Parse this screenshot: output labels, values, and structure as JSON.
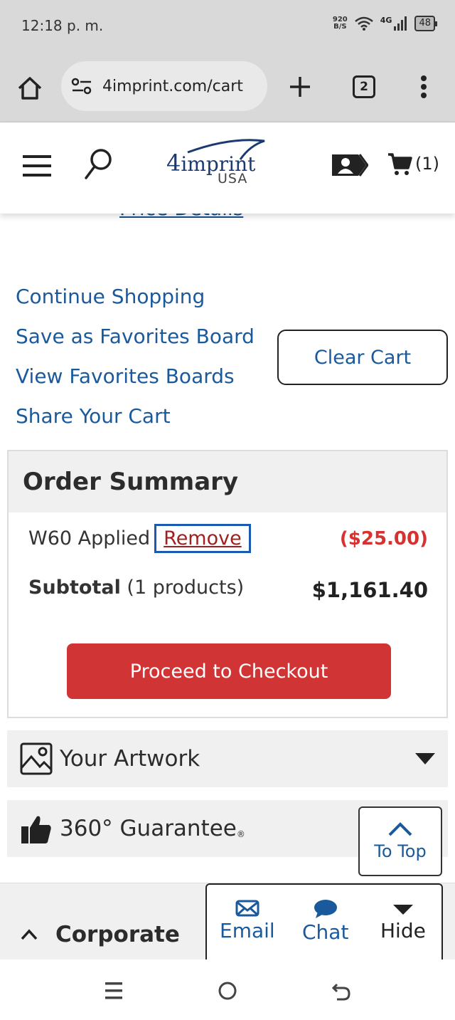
{
  "status_bar": {
    "time": "12:18 p. m.",
    "net_speed_value": "920",
    "net_speed_unit": "B/S",
    "network_type": "4G",
    "battery": "48"
  },
  "browser": {
    "url": "4imprint.com/cart",
    "tab_count": "2"
  },
  "header": {
    "logo_main": "imprint",
    "logo_four": "4",
    "logo_sub": "USA",
    "cart_count": "(1)"
  },
  "partial_link": "Price Details",
  "cart_links": {
    "continue": "Continue Shopping",
    "save_favorites": "Save as Favorites Board",
    "view_favorites": "View Favorites Boards",
    "share": "Share Your Cart",
    "clear_cart": "Clear Cart"
  },
  "order_summary": {
    "title": "Order Summary",
    "coupon_label": "W60 Applied",
    "remove_label": "Remove",
    "discount": "($25.00)",
    "subtotal_label": "Subtotal",
    "subtotal_count": " (1 products)",
    "subtotal_value": "$1,161.40",
    "checkout_label": "Proceed to Checkout"
  },
  "accordions": {
    "artwork": "Your Artwork",
    "guarantee": "360° Guarantee",
    "guarantee_mark": "®"
  },
  "to_top": "To Top",
  "footer": {
    "corporate": "Corporate",
    "email": "Email",
    "chat": "Chat",
    "hide": "Hide"
  },
  "colors": {
    "link": "#1a5a9c",
    "checkout": "#d03434",
    "discount": "#d63232"
  }
}
